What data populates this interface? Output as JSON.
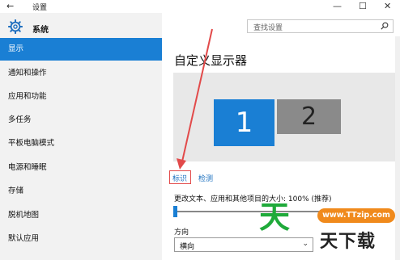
{
  "window": {
    "title": "设置",
    "back_icon": "←",
    "minimize": "—",
    "maximize": "☐",
    "close": "✕"
  },
  "sidebar": {
    "header_label": "系统",
    "items": [
      {
        "label": "显示",
        "active": true
      },
      {
        "label": "通知和操作"
      },
      {
        "label": "应用和功能"
      },
      {
        "label": "多任务"
      },
      {
        "label": "平板电脑模式"
      },
      {
        "label": "电源和睡眠"
      },
      {
        "label": "存储"
      },
      {
        "label": "脱机地图"
      },
      {
        "label": "默认应用"
      }
    ]
  },
  "search": {
    "placeholder": "查找设置"
  },
  "main": {
    "title": "自定义显示器",
    "monitors": [
      "1",
      "2"
    ],
    "identify": "标识",
    "detect": "检测",
    "scale_label": "更改文本、应用和其他项目的大小: 100% (推荐)",
    "scale_value": 100,
    "orientation_label": "方向",
    "orientation_value": "横向"
  },
  "watermark": {
    "url": "www.TTzip.com",
    "logo_char": "天",
    "name": "天下载"
  },
  "colors": {
    "accent": "#1a7fd4",
    "arrow": "#e24a4a",
    "watermark_green": "#1faa3a",
    "watermark_orange": "#f08a1c"
  }
}
